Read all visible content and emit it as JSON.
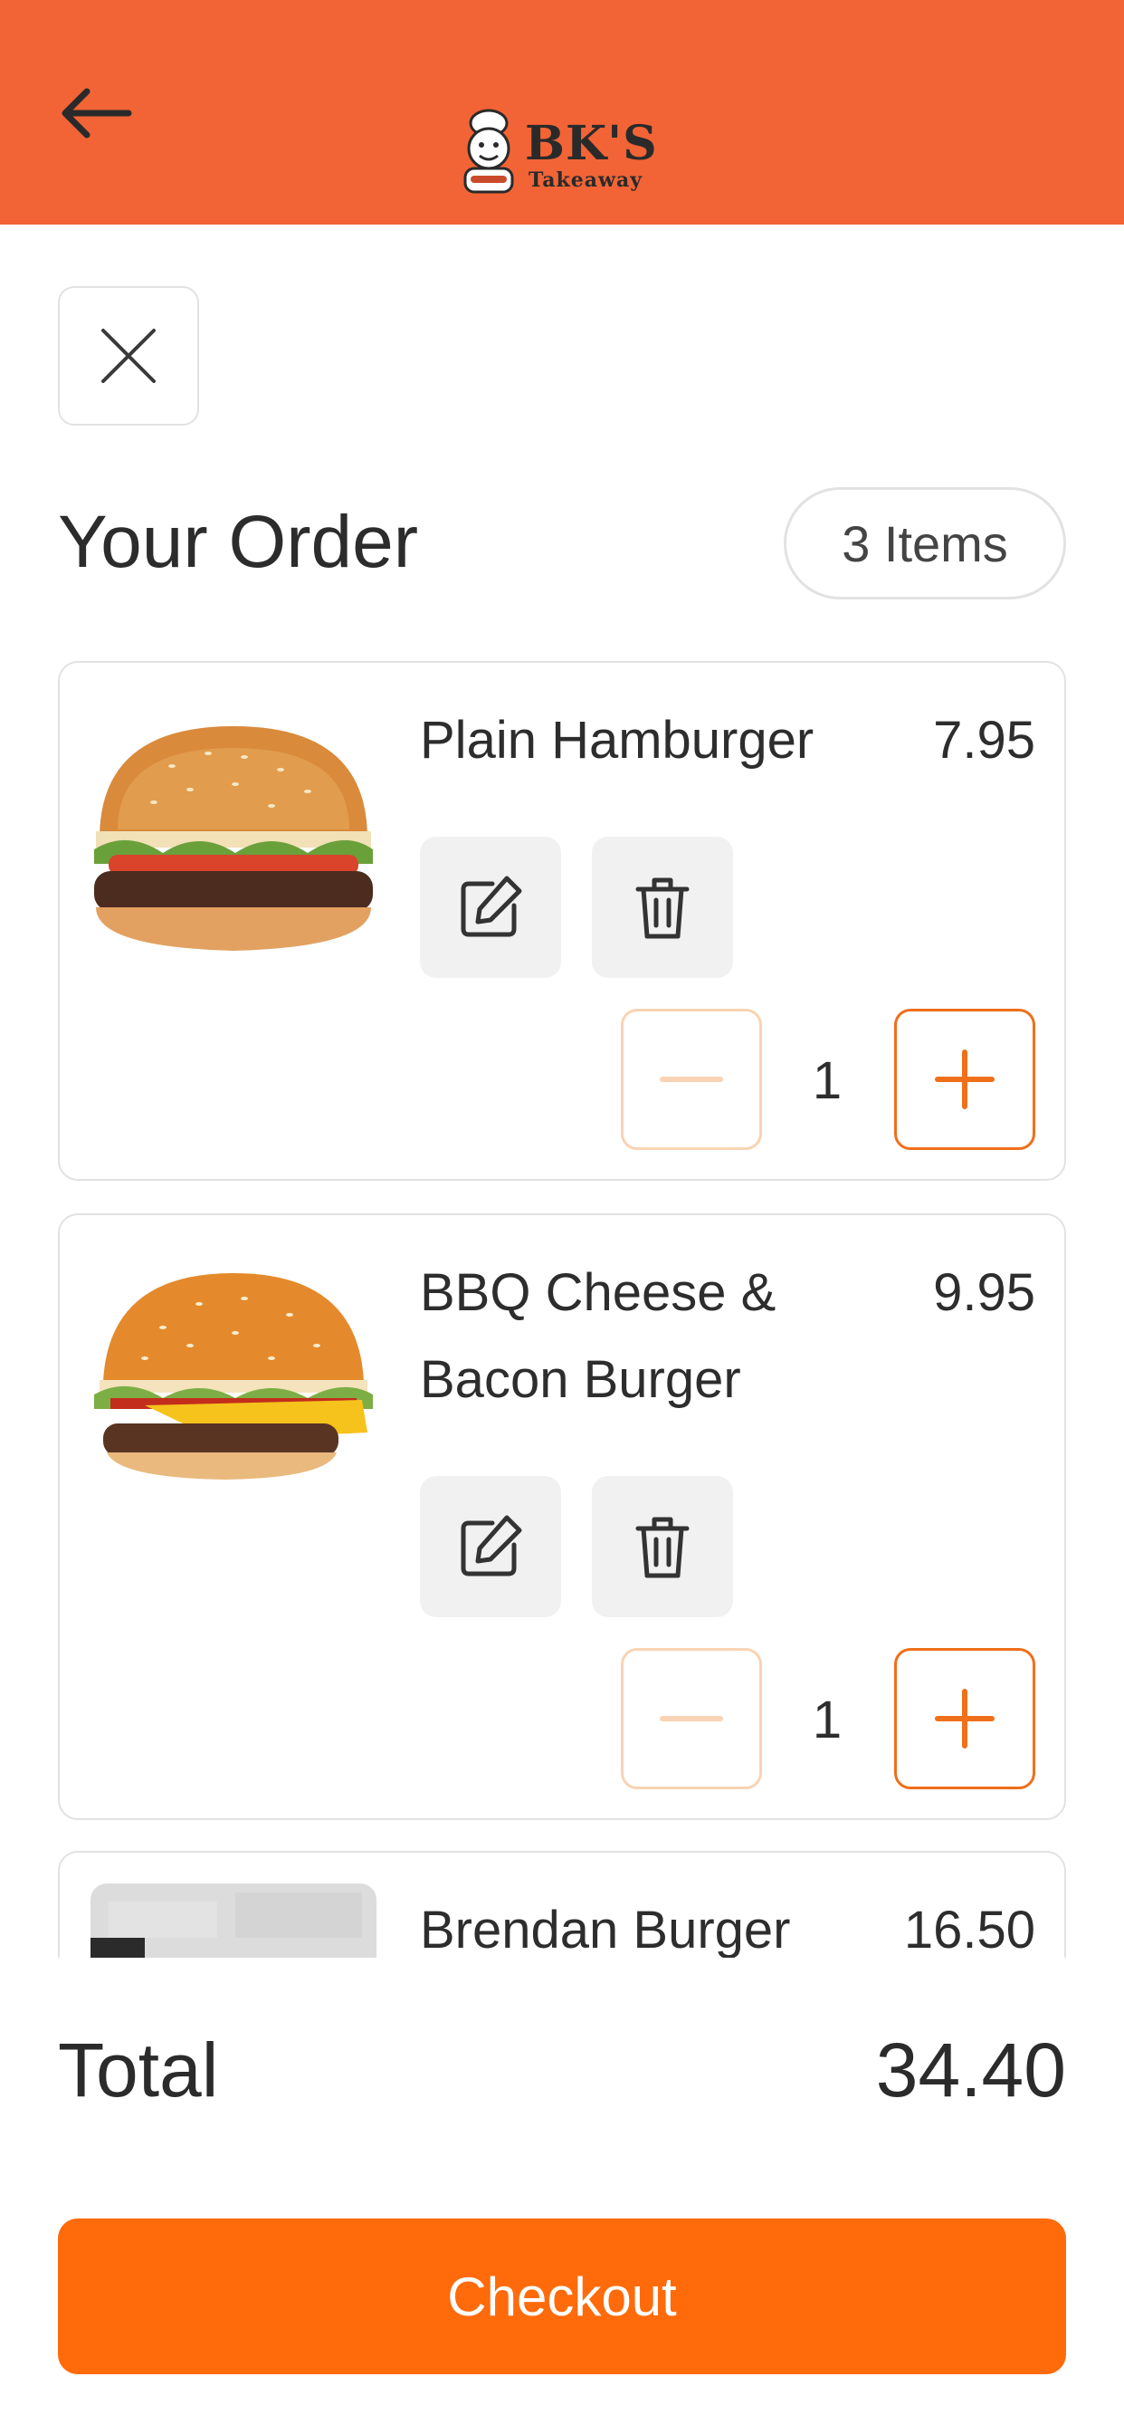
{
  "header": {
    "logo_text": "BK'S",
    "logo_subtext": "Takeaway",
    "background_color": "#f26436"
  },
  "order": {
    "title": "Your Order",
    "items_count_label": "3 Items"
  },
  "items": [
    {
      "name": "Plain Hamburger",
      "price": "7.95",
      "quantity": "1",
      "image": "hamburger-photo"
    },
    {
      "name": "BBQ Cheese & Bacon Burger",
      "price": "9.95",
      "quantity": "1",
      "image": "bbq-burger-photo"
    },
    {
      "name": "Brendan Burger",
      "price": "16.50",
      "quantity": "",
      "image": "brendan-burger-photo"
    }
  ],
  "total": {
    "label": "Total",
    "value": "34.40"
  },
  "checkout": {
    "label": "Checkout",
    "color": "#ff6a0a"
  },
  "icons": {
    "back": "arrow-left-icon",
    "close": "close-icon",
    "edit": "edit-icon",
    "delete": "trash-icon",
    "minus": "minus-icon",
    "plus": "plus-icon"
  }
}
